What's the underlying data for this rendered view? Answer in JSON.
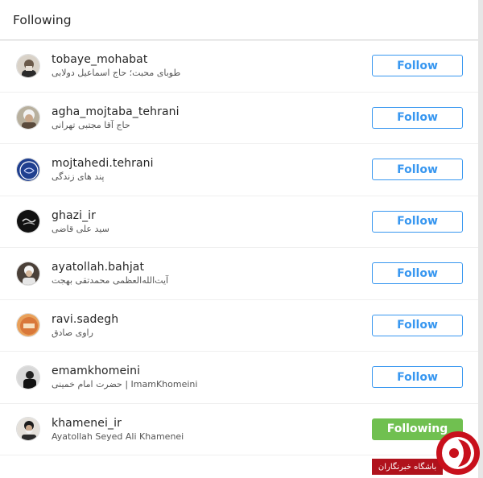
{
  "header": {
    "title": "Following"
  },
  "rows": [
    {
      "username": "tobaye_mohabat",
      "fullname": "طوبای محبت؛ حاج اسماعیل دولابی",
      "button": "Follow",
      "state": "follow"
    },
    {
      "username": "agha_mojtaba_tehrani",
      "fullname": "حاج آقا مجتبی تهرانی",
      "button": "Follow",
      "state": "follow"
    },
    {
      "username": "mojtahedi.tehrani",
      "fullname": "پند های زندگی",
      "button": "Follow",
      "state": "follow"
    },
    {
      "username": "ghazi_ir",
      "fullname": "سید علی قاضی",
      "button": "Follow",
      "state": "follow"
    },
    {
      "username": "ayatollah.bahjat",
      "fullname": "آیت‌الله‌العظمی محمدتقی بهجت",
      "button": "Follow",
      "state": "follow"
    },
    {
      "username": "ravi.sadegh",
      "fullname": "راوی صادق",
      "button": "Follow",
      "state": "follow"
    },
    {
      "username": "emamkhomeini",
      "fullname": "حضرت امام خمینی | ImamKhomeini",
      "button": "Follow",
      "state": "follow"
    },
    {
      "username": "khamenei_ir",
      "fullname": "Ayatollah Seyed Ali Khamenei",
      "button": "Following",
      "state": "following"
    }
  ],
  "watermark": {
    "text": "باشگاه خبرنگاران"
  },
  "colors": {
    "accent": "#3897f0",
    "following": "#70c050",
    "watermark": "#b0121c"
  }
}
